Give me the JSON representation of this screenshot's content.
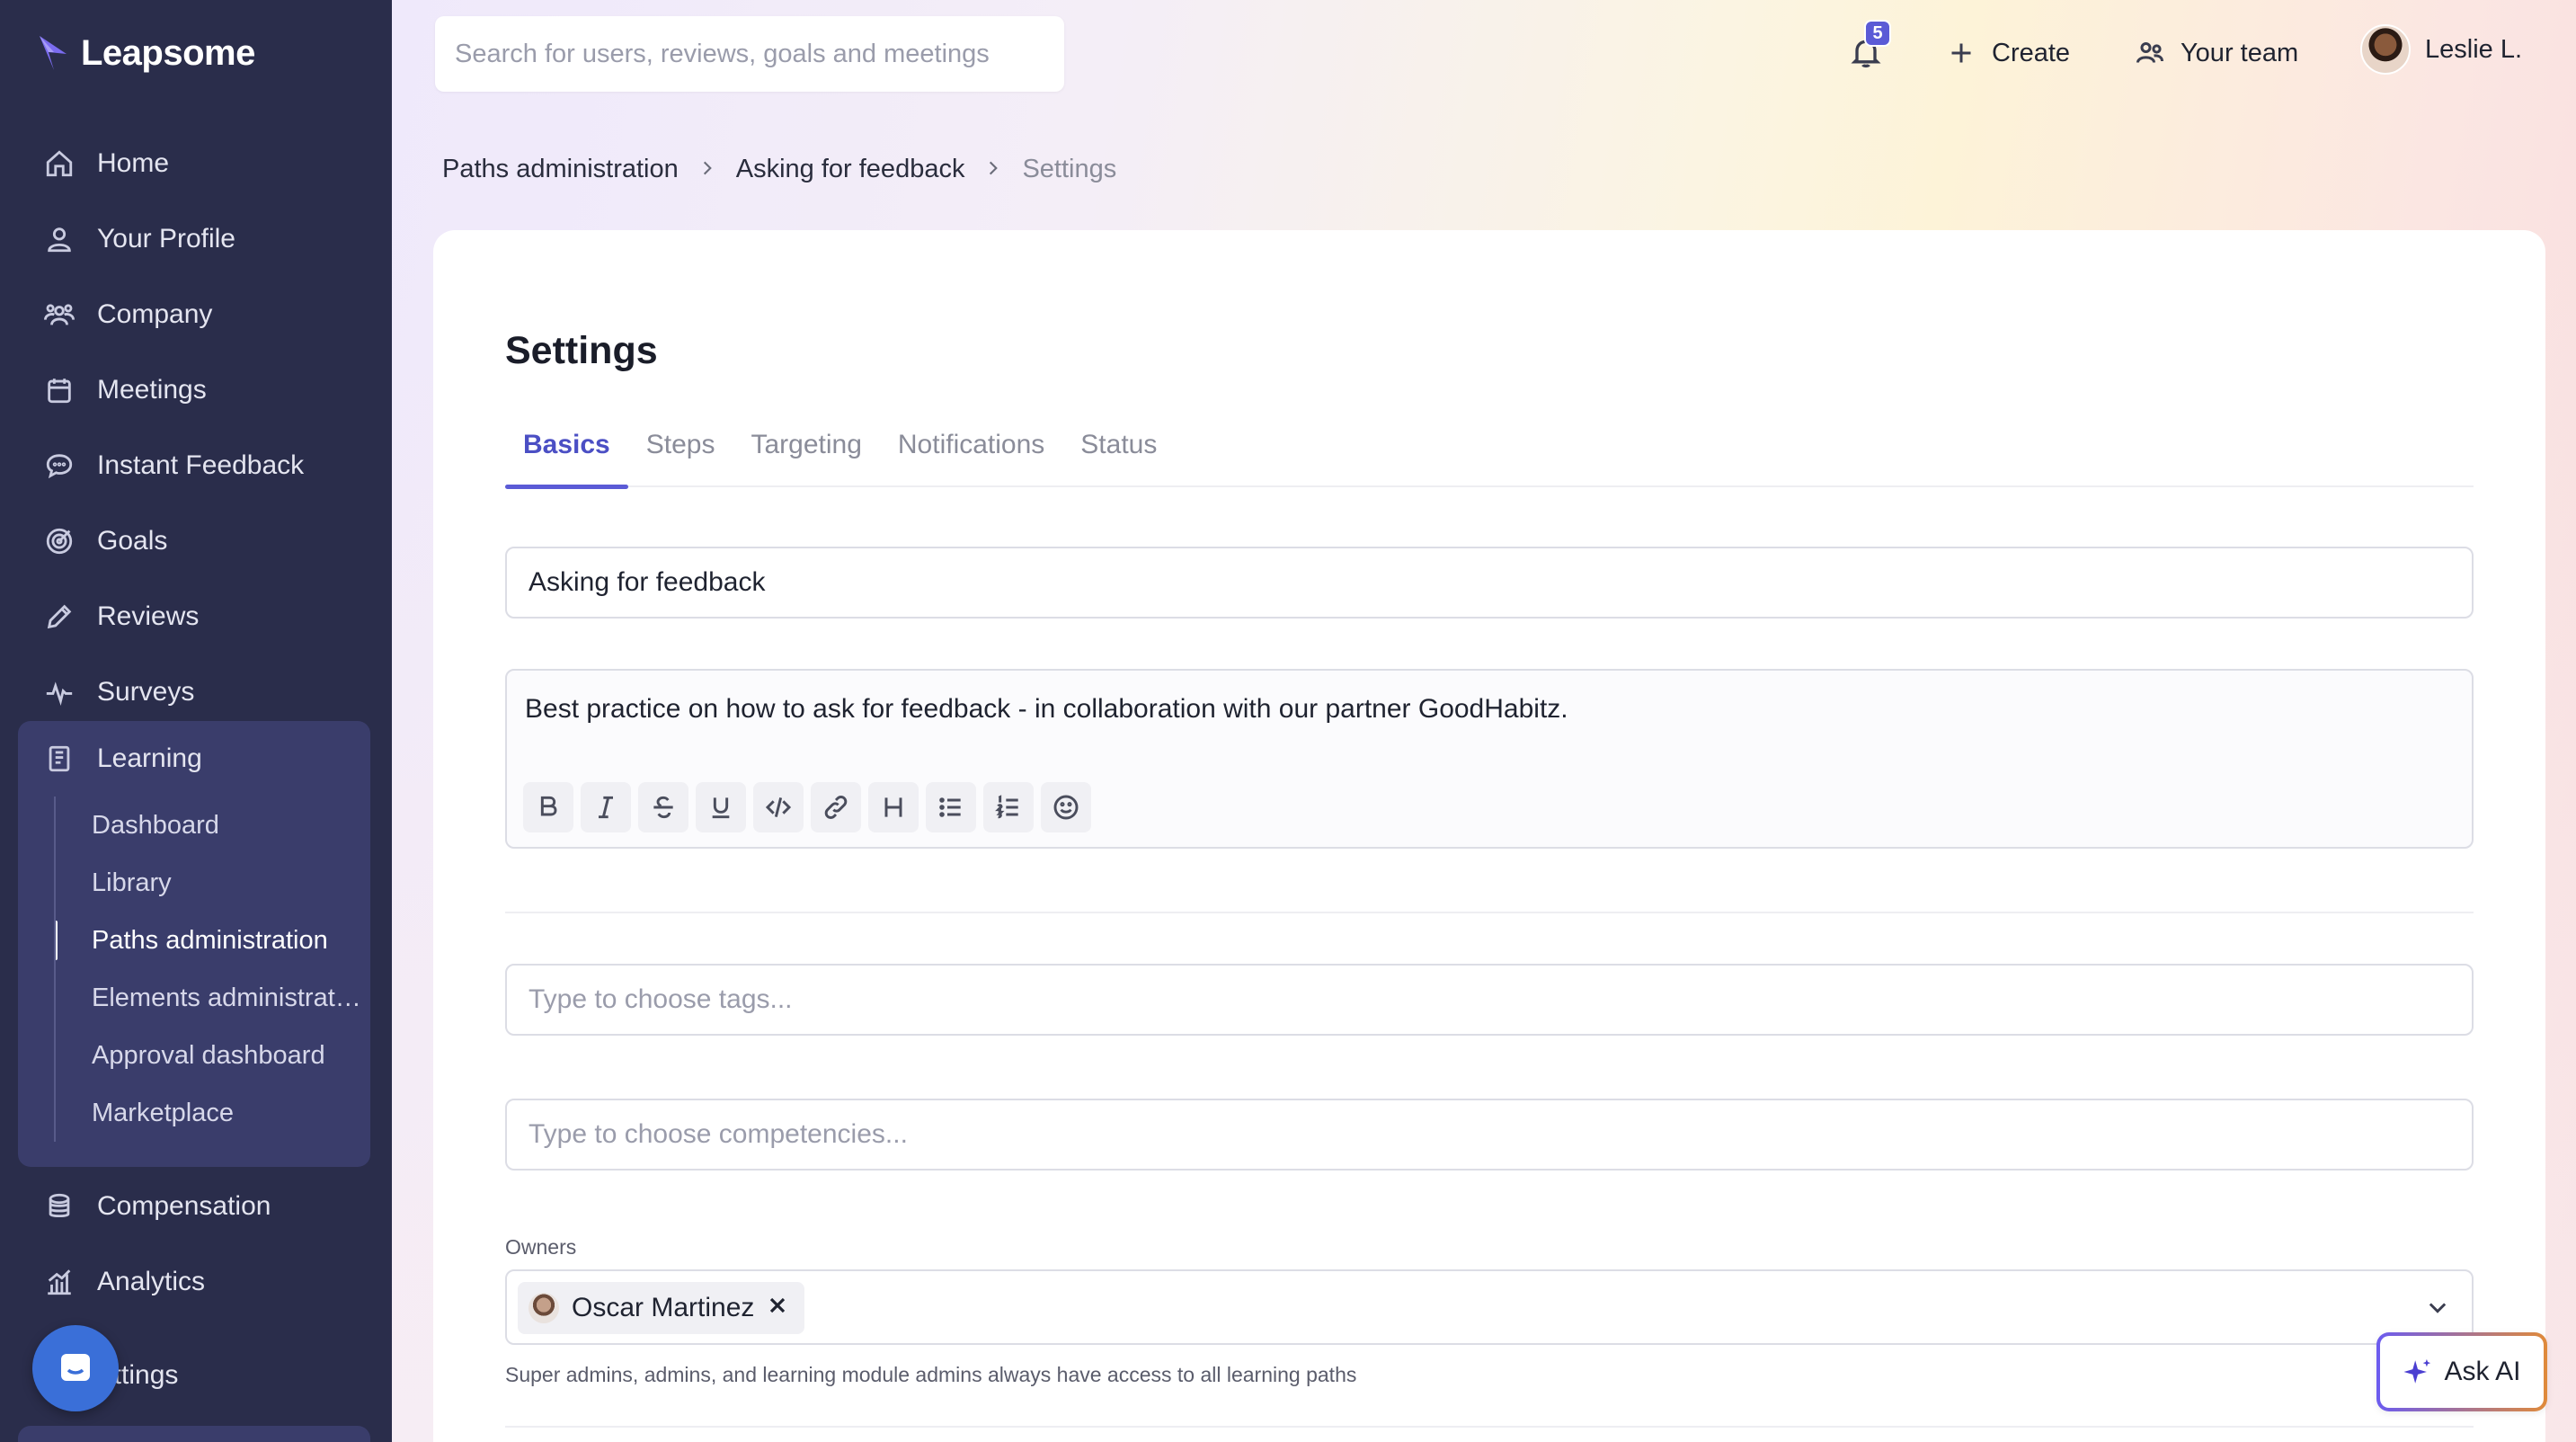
{
  "app": {
    "logo_text": "Leapsome"
  },
  "sidebar": {
    "items": [
      {
        "label": "Home",
        "icon": "home-icon"
      },
      {
        "label": "Your Profile",
        "icon": "user-icon"
      },
      {
        "label": "Company",
        "icon": "users-icon"
      },
      {
        "label": "Meetings",
        "icon": "calendar-icon"
      },
      {
        "label": "Instant Feedback",
        "icon": "chat-icon"
      },
      {
        "label": "Goals",
        "icon": "target-icon"
      },
      {
        "label": "Reviews",
        "icon": "pencil-icon"
      },
      {
        "label": "Surveys",
        "icon": "pulse-icon"
      }
    ],
    "learning": {
      "label": "Learning",
      "icon": "book-icon",
      "sub_items": [
        "Dashboard",
        "Library",
        "Paths administration",
        "Elements administrat…",
        "Approval dashboard",
        "Marketplace"
      ],
      "active_sub_item": "Paths administration"
    },
    "bottom_items": [
      {
        "label": "Compensation",
        "icon": "coins-icon"
      },
      {
        "label": "Analytics",
        "icon": "bar-chart-icon"
      },
      {
        "label": "ettings",
        "icon": "gear-icon"
      }
    ]
  },
  "header": {
    "search_placeholder": "Search for users, reviews, goals and meetings",
    "notification_count": "5",
    "create_label": "Create",
    "team_label": "Your team",
    "user_name": "Leslie L."
  },
  "breadcrumb": [
    "Paths administration",
    "Asking for feedback",
    "Settings"
  ],
  "page": {
    "title": "Settings",
    "tabs": [
      "Basics",
      "Steps",
      "Targeting",
      "Notifications",
      "Status"
    ],
    "active_tab": "Basics",
    "title_value": "Asking for feedback",
    "description": "Best practice on how to ask for feedback - in collaboration with our partner GoodHabitz.",
    "toolbar": [
      "bold-icon",
      "italic-icon",
      "strikethrough-icon",
      "underline-icon",
      "code-icon",
      "link-icon",
      "heading-icon",
      "bullet-list-icon",
      "numbered-list-icon",
      "emoji-icon"
    ],
    "tags_placeholder": "Type to choose tags...",
    "competencies_placeholder": "Type to choose competencies...",
    "owners_label": "Owners",
    "owner_chip": "Oscar Martinez",
    "owners_help": "Super admins, admins, and learning module admins always have access to all learning paths"
  },
  "ask_ai": {
    "label": "Ask AI"
  },
  "colors": {
    "sidebar_bg": "#2a2d4b",
    "accent": "#5b5bd6",
    "learning_group_bg": "#3a3d6b"
  }
}
